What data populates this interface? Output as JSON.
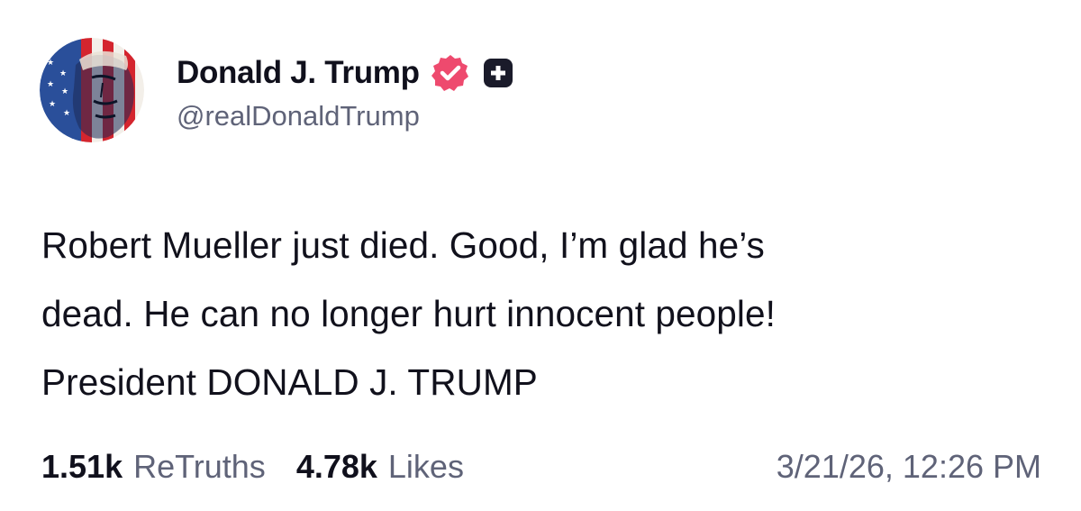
{
  "post": {
    "author": {
      "display_name": "Donald J. Trump",
      "handle": "@realDonaldTrump",
      "verified_badge_icon": "verified-rosette-icon",
      "plus_badge_icon": "plus-square-icon",
      "avatar_icon": "flag-portrait-avatar"
    },
    "body_lines": [
      "Robert Mueller just died. Good, I’m glad he’s",
      "dead. He can no longer hurt innocent people!",
      "President DONALD J. TRUMP"
    ],
    "stats": {
      "retruths_count": "1.51k",
      "retruths_label": "ReTruths",
      "likes_count": "4.78k",
      "likes_label": "Likes"
    },
    "timestamp": "3/21/26, 12:26 PM"
  },
  "colors": {
    "verified_badge": "#ee4a6e",
    "plus_badge": "#1a1b2a",
    "muted_text": "#5f6378",
    "primary_text": "#10101c"
  }
}
